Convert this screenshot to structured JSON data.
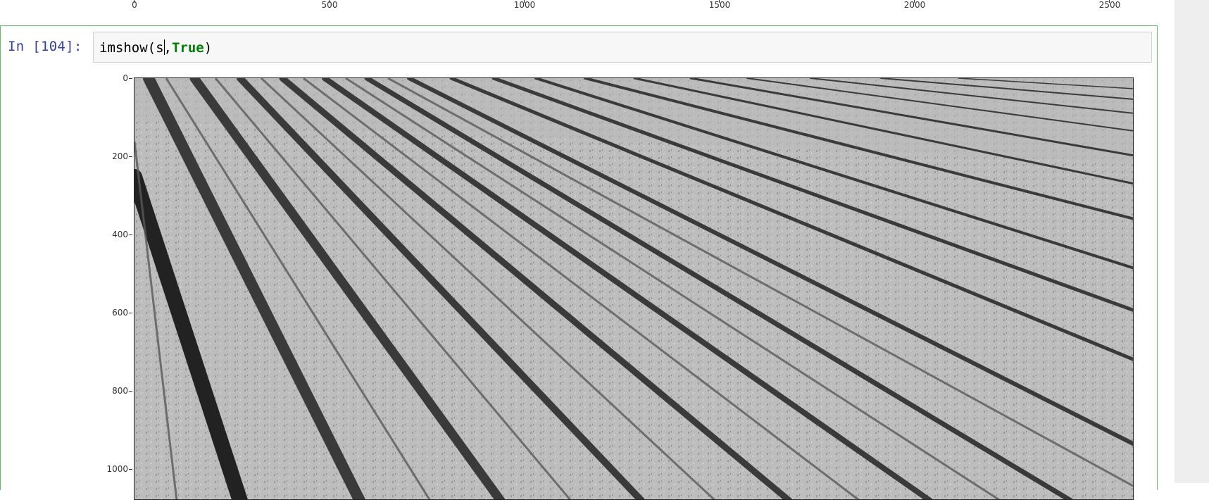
{
  "previous_output": {
    "x_ticks": [
      "0",
      "500",
      "1000",
      "1500",
      "2000",
      "2500"
    ]
  },
  "cell": {
    "prompt": "In [104]:",
    "code_before_cursor": "imshow(s",
    "code_after_cursor": ",",
    "code_keyword": "True",
    "code_end": ")"
  },
  "figure": {
    "y_ticks": [
      "0",
      "200",
      "400",
      "600",
      "800",
      "1000"
    ],
    "image_description_name": "grayscale-field-rows-image"
  },
  "colors": {
    "cell_border": "#66bb6a",
    "prompt_color": "#303f9f",
    "keyword_color": "#008000",
    "input_bg": "#f7f7f7"
  }
}
